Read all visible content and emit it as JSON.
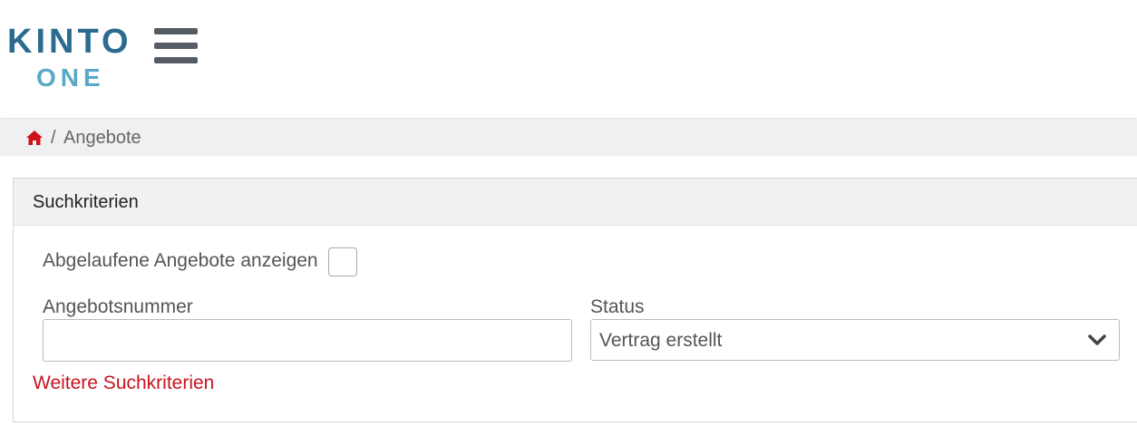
{
  "brand": {
    "logo_top": "KINTO",
    "logo_bottom": "ONE"
  },
  "nav": {
    "menu_icon": "hamburger-menu-icon"
  },
  "breadcrumb": {
    "home_icon": "home-icon",
    "separator": "/",
    "current": "Angebote"
  },
  "search": {
    "title": "Suchkriterien",
    "expired_label": "Abgelaufene Angebote anzeigen",
    "expired_checked": false,
    "offer_number_label": "Angebotsnummer",
    "offer_number_value": "",
    "status_label": "Status",
    "status_value": "Vertrag erstellt",
    "more_link": "Weitere Suchkriterien"
  },
  "colors": {
    "accent_red": "#c8141e",
    "brand_blue": "#2b6b8f",
    "brand_light_blue": "#5aa8c8"
  }
}
